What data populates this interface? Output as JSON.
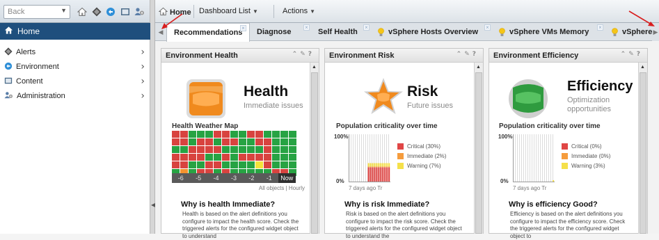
{
  "nav": {
    "back_label": "Back",
    "home_label": "Home",
    "items": [
      {
        "label": "Alerts"
      },
      {
        "label": "Environment"
      },
      {
        "label": "Content"
      },
      {
        "label": "Administration"
      }
    ]
  },
  "toolbar": {
    "home_label": "Home",
    "dashboard_list_label": "Dashboard List",
    "actions_label": "Actions"
  },
  "tabs": [
    {
      "label": "Recommendations",
      "active": true
    },
    {
      "label": "Diagnose"
    },
    {
      "label": "Self Health"
    },
    {
      "label": "vSphere Hosts Overview"
    },
    {
      "label": "vSphere VMs Memory"
    },
    {
      "label": "vSphere"
    }
  ],
  "widgets": {
    "health": {
      "title": "Environment Health",
      "big_title": "Health",
      "subtitle": "Immediate issues",
      "map_label": "Health Weather Map",
      "timeline": [
        "-6",
        "-5",
        "-4",
        "-3",
        "-2",
        "-1",
        "Now"
      ],
      "footer": "All objects | Hourly",
      "why_title": "Why is health Immediate?",
      "description": "Health is based on the alert definitions you configure to impact the health score. Check the triggered alerts for the configured widget object to understand",
      "grid_rows": [
        "RRGGGRRGGRRGGGG",
        "RRGRRGRRGGRRGGG",
        "GGRRRRGGGGGRGGG",
        "RRRRGGRGRRRRGGG",
        "RRGGRRGGGGYRGGG",
        "GOGRRGRGGGGGRRG"
      ],
      "colors": {
        "R": "#d8433f",
        "G": "#27a343",
        "Y": "#f3e33a",
        "O": "#f5932e"
      }
    },
    "risk": {
      "title": "Environment Risk",
      "big_title": "Risk",
      "subtitle": "Future issues",
      "chart_label": "Population criticality over time",
      "y_top": "100%",
      "y_bottom": "0%",
      "time_label": "7 days ago Tr",
      "legend": [
        {
          "label": "Critical (30%)",
          "color": "#e04645"
        },
        {
          "label": "Immediate (2%)",
          "color": "#f59c3d"
        },
        {
          "label": "Warning (7%)",
          "color": "#f5e04a"
        }
      ],
      "why_title": "Why is risk Immediate?",
      "description": "Risk is based on the alert definitions you configure to impact the risk score. Check the triggered alerts for the configured widget object to understand the"
    },
    "efficiency": {
      "title": "Environment Efficiency",
      "big_title": "Efficiency",
      "subtitle": "Optimization opportunities",
      "chart_label": "Population criticality over time",
      "y_top": "100%",
      "y_bottom": "0%",
      "time_label": "7 days ago Tr",
      "legend": [
        {
          "label": "Critical (0%)",
          "color": "#e04645"
        },
        {
          "label": "Immediate (0%)",
          "color": "#f59c3d"
        },
        {
          "label": "Warning (3%)",
          "color": "#f5e04a"
        }
      ],
      "why_title": "Why is efficiency Good?",
      "description": "Efficiency is based on the alert definitions you configure to impact the efficiency score. Check the triggered alerts for the configured widget object to"
    }
  },
  "colors": {
    "nav_selected": "#1f4f7d",
    "health_badge": "#f08a1e",
    "risk_badge": "#f08a1e",
    "efficiency_badge": "#2f9b3f",
    "annotation_arrow": "#d81e1e"
  }
}
